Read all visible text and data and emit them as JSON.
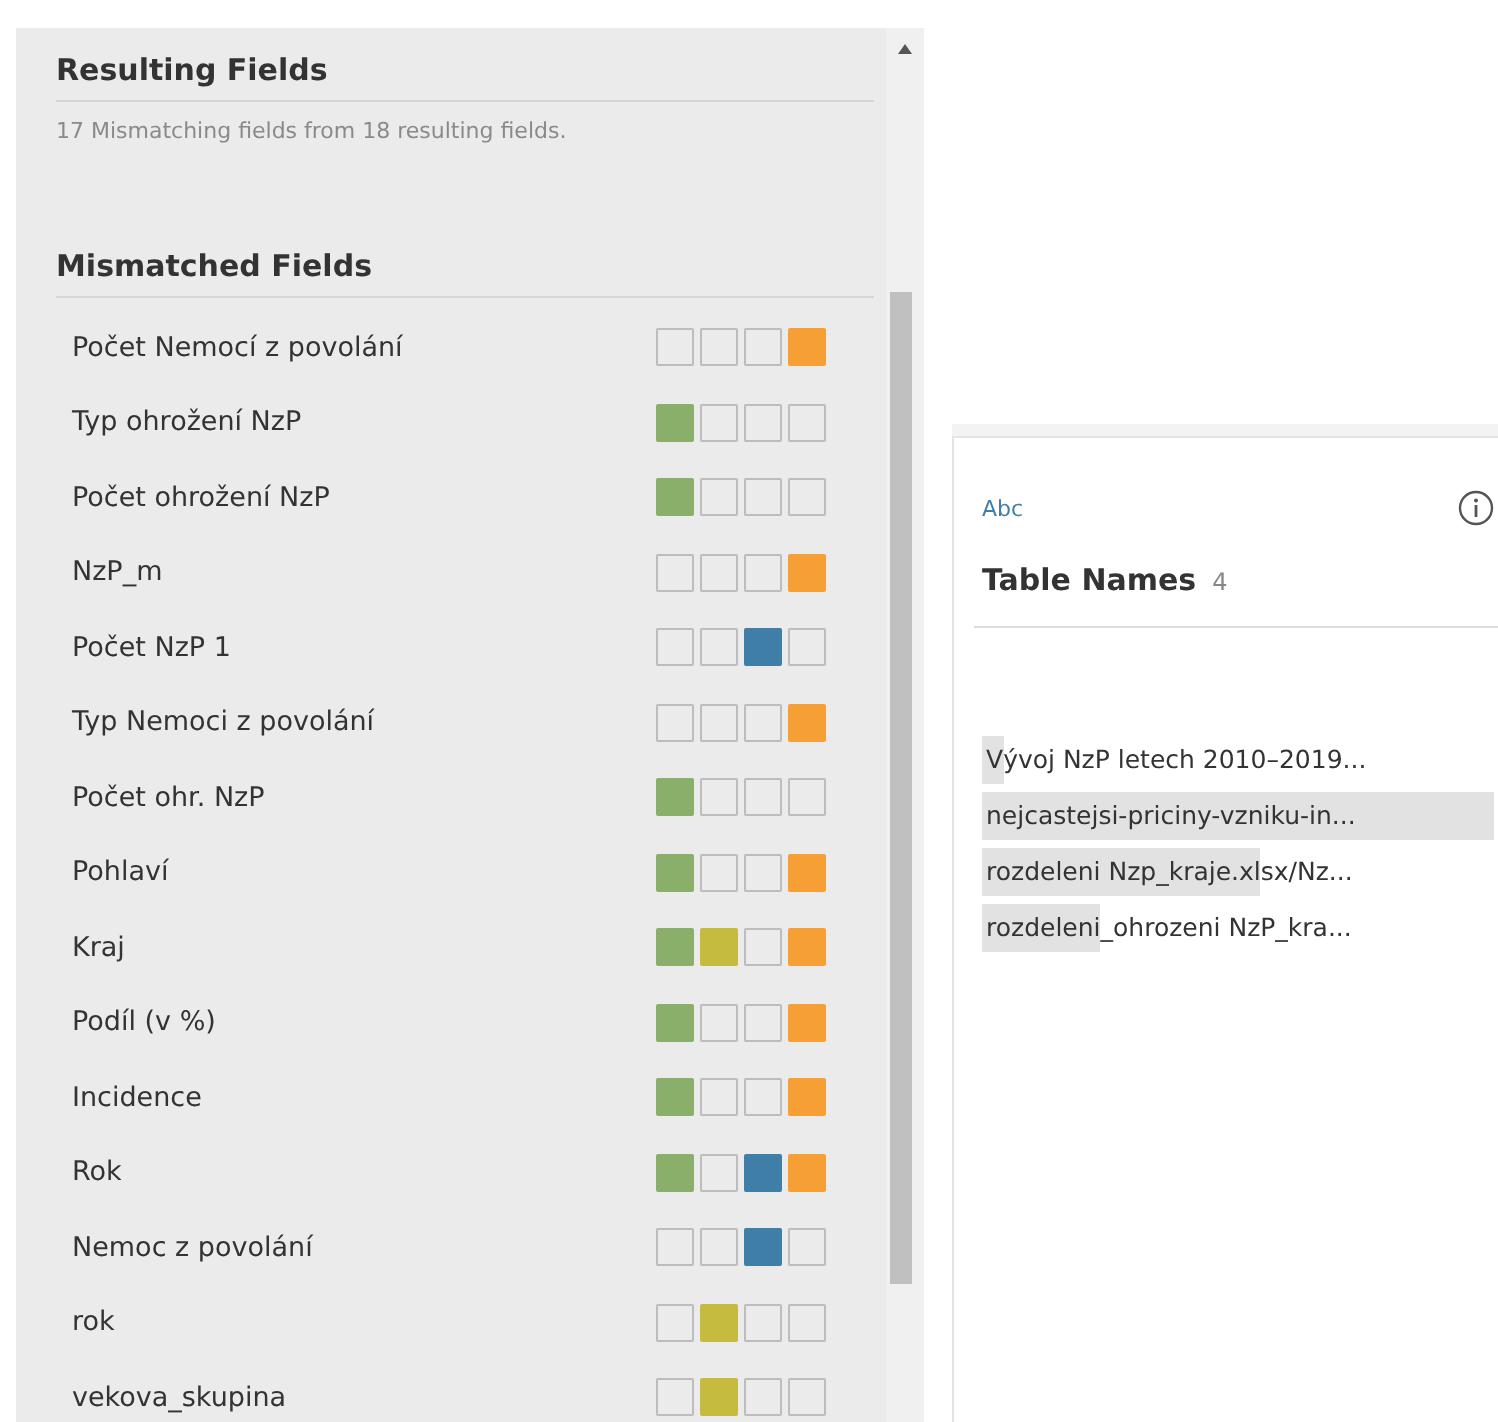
{
  "resulting": {
    "title": "Resulting Fields",
    "summary": "17 Mismatching fields from 18 resulting fields."
  },
  "mismatched": {
    "title": "Mismatched Fields",
    "source_tables": [
      {
        "color": "#8aaf6a"
      },
      {
        "color": "#c4bb3f"
      },
      {
        "color": "#3f7ea6"
      },
      {
        "color": "#f59f35"
      }
    ],
    "fields": [
      {
        "name": "Počet Nemocí z povolání",
        "present": [
          false,
          false,
          false,
          true
        ]
      },
      {
        "name": "Typ ohrožení NzP",
        "present": [
          true,
          false,
          false,
          false
        ]
      },
      {
        "name": "Počet ohrožení NzP",
        "present": [
          true,
          false,
          false,
          false
        ]
      },
      {
        "name": "NzP_m",
        "present": [
          false,
          false,
          false,
          true
        ]
      },
      {
        "name": "Počet NzP 1",
        "present": [
          false,
          false,
          true,
          false
        ]
      },
      {
        "name": "Typ Nemoci z povolání",
        "present": [
          false,
          false,
          false,
          true
        ]
      },
      {
        "name": "Počet ohr. NzP",
        "present": [
          true,
          false,
          false,
          false
        ]
      },
      {
        "name": "Pohlaví",
        "present": [
          true,
          false,
          false,
          true
        ]
      },
      {
        "name": "Kraj",
        "present": [
          true,
          true,
          false,
          true
        ]
      },
      {
        "name": "Podíl (v %)",
        "present": [
          true,
          false,
          false,
          true
        ]
      },
      {
        "name": "Incidence",
        "present": [
          true,
          false,
          false,
          true
        ]
      },
      {
        "name": "Rok",
        "present": [
          true,
          false,
          true,
          true
        ]
      },
      {
        "name": "Nemoc z povolání",
        "present": [
          false,
          false,
          true,
          false
        ]
      },
      {
        "name": "rok",
        "present": [
          false,
          true,
          false,
          false
        ]
      },
      {
        "name": "vekova_skupina",
        "present": [
          false,
          true,
          false,
          false
        ]
      }
    ]
  },
  "card": {
    "type_label": "Abc",
    "title": "Table Names",
    "count": "4",
    "values": [
      {
        "highlighted": "V",
        "rest": "ývoj NzP letech 2010–2019..."
      },
      {
        "highlighted": "nejcastejsi-priciny-vzniku-in..."
      },
      {
        "highlighted": "rozdeleni Nzp_kraje.xl",
        "rest": "sx/Nz..."
      },
      {
        "highlighted": "rozdeleni",
        "rest": "_ohrozeni NzP_kra..."
      }
    ]
  }
}
